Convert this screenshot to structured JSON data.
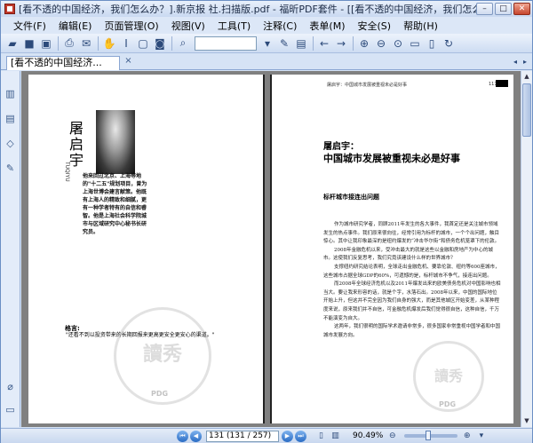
{
  "window": {
    "title": "[看不透的中国经济，我们怎么办？].新京报 社.扫描版.pdf - 福昕PDF套件 - [[看不透的中国经济，我们怎么办？]..."
  },
  "menu": [
    "文件(F)",
    "编辑(E)",
    "页面管理(O)",
    "视图(V)",
    "工具(T)",
    "注释(C)",
    "表单(M)",
    "安全(S)",
    "帮助(H)"
  ],
  "tab": {
    "label": "[看不透的中国经济...",
    "close": "×"
  },
  "left_page": {
    "name": "屠启宇",
    "pinyin": "TUQIYU",
    "bio": "他来回过北京、上海等地的\"十二五\"规划项目，曾为上海世博会建言献策。他既有上海人的精致和细腻，更有一种学者特有的自信和睿智。他是上海社会科学院城市与区域研究中心秘书长研究员。",
    "quote_label": "格言:",
    "quote": "\"还看不到以投资带来的长期回报来更高更安全更安心的渠道。\""
  },
  "right_page": {
    "header": "屠启宇：中国城市发展被重视未必是好事",
    "page_number": "117",
    "title_line1": "屠启宇：",
    "title_line2": "中国城市发展被重视未必是好事",
    "section": "标杆城市接连出问题",
    "paragraphs": [
      "作为城市研究学者，同顾2011年发生的各大事件，我首定还是关注城市领域发生的热点事件。我们原来很向往，经常引用为标杆的城市，一个个出问题，触目惊心。其中让我印象最深的是纽约爆发的“冲击华尔街”和债务危机笼罩下的伦敦。",
      "2008年金融危机以来，受冲击最大的就是这些以金融和房地产为中心的城市。这使我们反复思考，我们究竟该建设什么样的世界城市？",
      "支撑纽约研究结论表明，全球走出金融危机、要靠伦敦、纽约等600座城市，这些城市占据全球GDP的60%，可遗憾的是，标杆城市不争气，接连出问题。",
      "而2008年全球经济危机以及2011年爆发出来的欧美债务危机对中国影响也相当大。要让我来形容的话，就是个字，水落石出。2008年以来，中国的国际地位开始上升，但这并不完全因为我们自身的强大，而是其他城区开始变差，从某种程度来说，原来我们并不自信，可金融危机爆发后我们觉得很自信，这种自信，千万不能演变为自大。",
      "这两年，我们很明的国际学术邀请非常多，很多国家非常重视中国学者和中国城市发展方向。"
    ]
  },
  "watermark": {
    "text": "PDG"
  },
  "status": {
    "page_field": "131 (131 / 257)",
    "zoom": "90.49%"
  },
  "colors": {
    "chrome": "#d6e3f5",
    "doc_background": "#808080",
    "accent": "#2a6cc4"
  }
}
